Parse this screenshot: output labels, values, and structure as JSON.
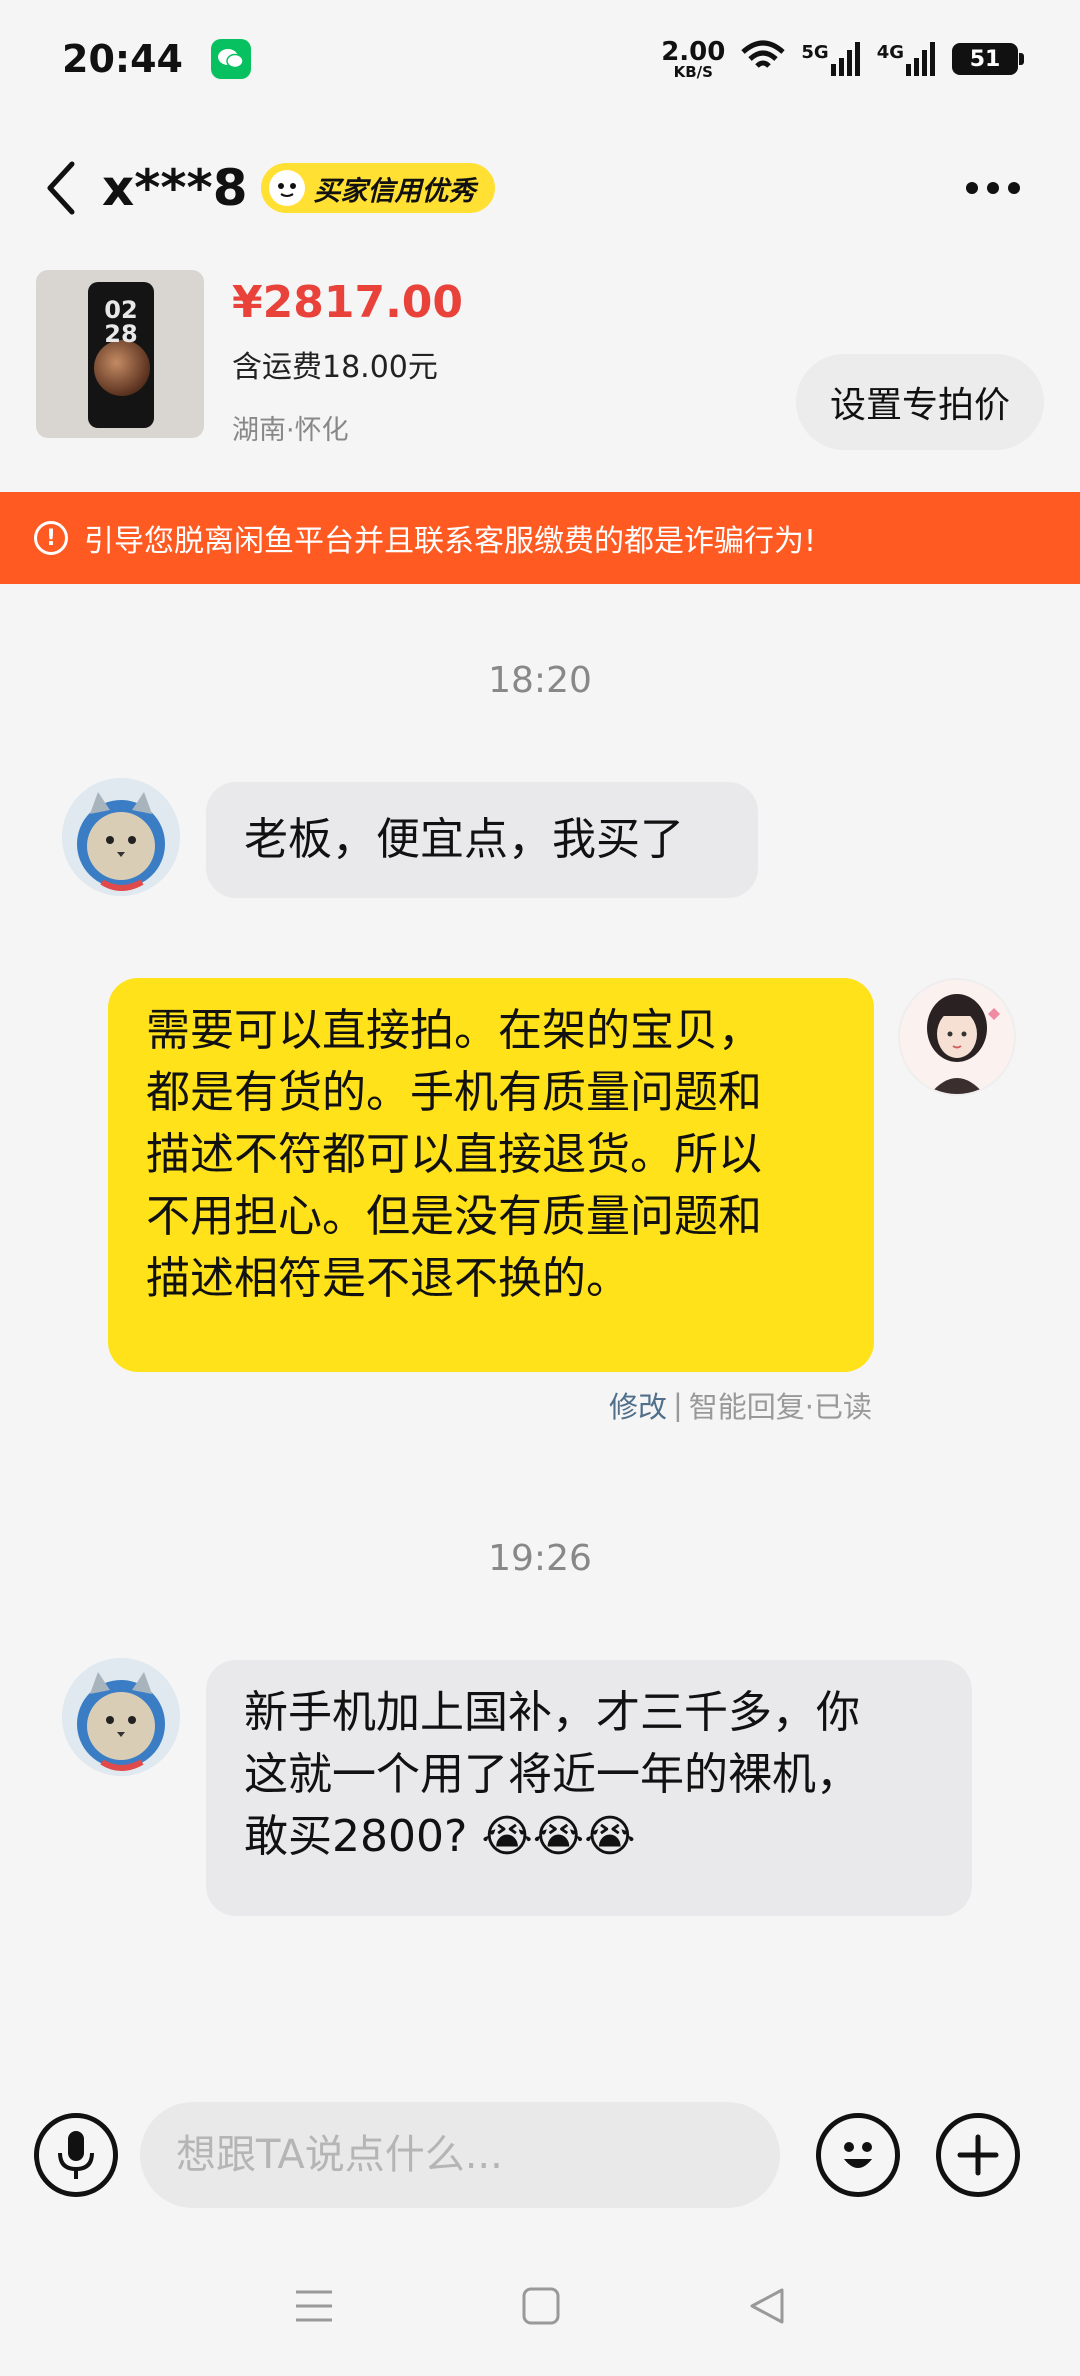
{
  "status_bar": {
    "time": "20:44",
    "net_speed_value": "2.00",
    "net_speed_unit": "KB/S",
    "signal_1": "5G",
    "signal_2": "4G",
    "battery": "51"
  },
  "header": {
    "user_name": "x***8",
    "badge_label": "买家信用优秀"
  },
  "product": {
    "price": "¥2817.00",
    "shipping": "含运费18.00元",
    "location": "湖南·怀化",
    "set_price_label": "设置专拍价",
    "thumb_clock": "02\n28"
  },
  "warning": {
    "text": "引导您脱离闲鱼平台并且联系客服缴费的都是诈骗行为!"
  },
  "chat": {
    "time_1": "18:20",
    "msg_1": "老板，便宜点，我买了",
    "msg_2_lines": [
      "需要可以直接拍。在架的宝贝，",
      "都是有货的。手机有质量问题和",
      "描述不符都可以直接退货。所以",
      "不用担心。但是没有质量问题和",
      "描述相符是不退不换的。"
    ],
    "msg_2_edit": "修改",
    "msg_2_status": "智能回复·已读",
    "time_2": "19:26",
    "msg_3_lines": [
      "新手机加上国补，才三千多，你",
      "这就一个用了将近一年的裸机，",
      "敢买2800?"
    ],
    "msg_3_emoji": "😭😭😭"
  },
  "input": {
    "placeholder": "想跟TA说点什么..."
  },
  "colors": {
    "accent_yellow": "#ffe21a",
    "warning_orange": "#ff5a22",
    "price_red": "#e8423a"
  },
  "icons": [
    "back-icon",
    "more-icon",
    "voice-icon",
    "emoji-icon",
    "plus-icon",
    "menu-icon",
    "home-icon",
    "back-nav-icon",
    "wechat-icon",
    "wifi-icon",
    "signal-icon",
    "battery-icon",
    "warning-icon"
  ]
}
